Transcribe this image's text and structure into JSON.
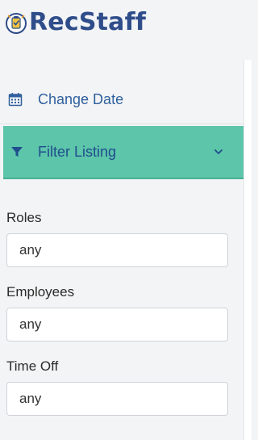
{
  "header": {
    "app_name": "RecStaff",
    "logo_icon": "clipboard-check-icon"
  },
  "sidebar": {
    "items": [
      {
        "label": "Change Date",
        "icon": "calendar-icon"
      },
      {
        "label": "Filter Listing",
        "icon": "filter-icon",
        "expanded": true,
        "accent": "#5cc5aa"
      }
    ]
  },
  "filters": [
    {
      "label": "Roles",
      "value": "any"
    },
    {
      "label": "Employees",
      "value": "any"
    },
    {
      "label": "Time Off",
      "value": "any"
    }
  ],
  "colors": {
    "brand": "#2f4d8a",
    "accent": "#5cc5aa",
    "link": "#2f5f9e",
    "background": "#f3f4f5"
  }
}
